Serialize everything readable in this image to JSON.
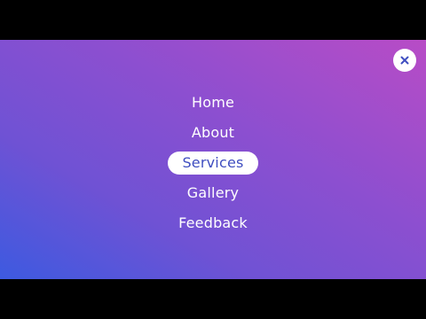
{
  "colors": {
    "accent": "#3f4ec0",
    "gradient_start": "#3d5ae0",
    "gradient_end": "#b84cc6",
    "text": "#ffffff"
  },
  "close_button": {
    "icon": "close-icon"
  },
  "menu": {
    "items": [
      {
        "label": "Home",
        "active": false
      },
      {
        "label": "About",
        "active": false
      },
      {
        "label": "Services",
        "active": true
      },
      {
        "label": "Gallery",
        "active": false
      },
      {
        "label": "Feedback",
        "active": false
      }
    ]
  }
}
